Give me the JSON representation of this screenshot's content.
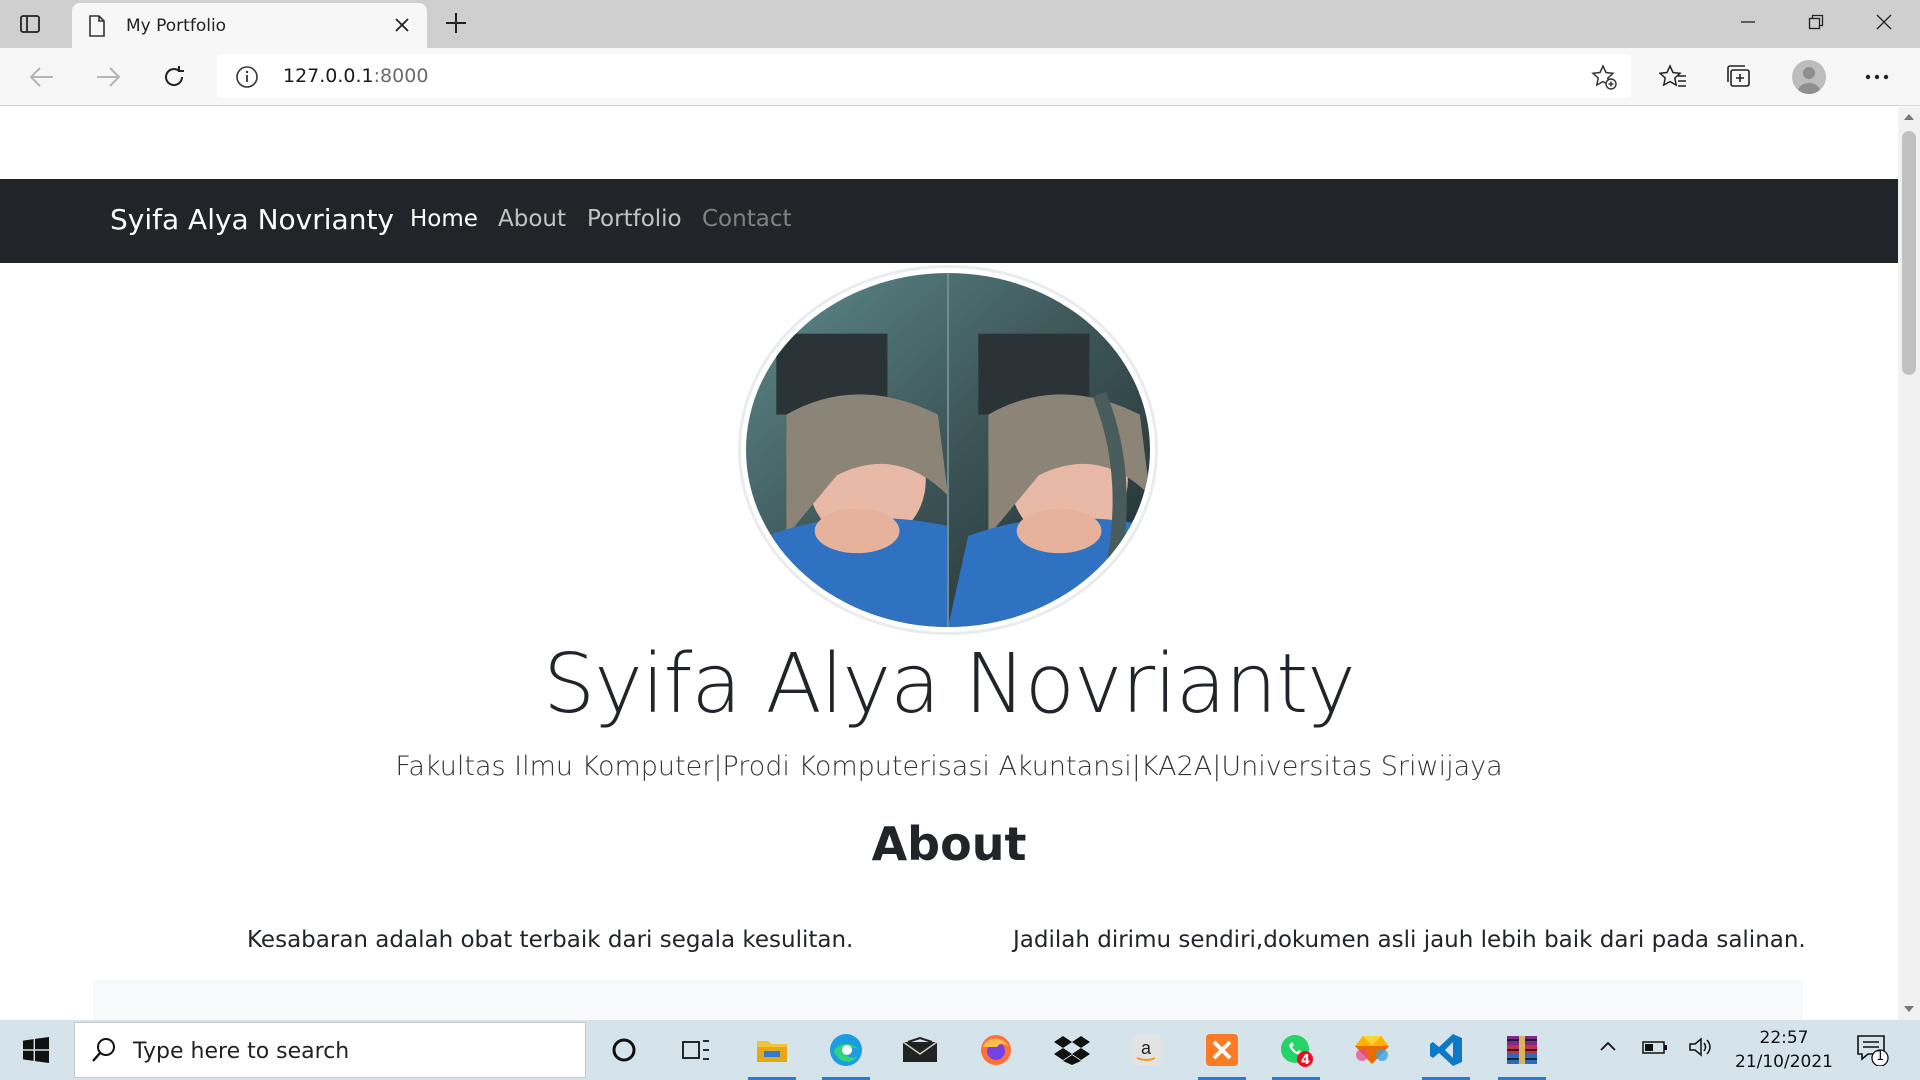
{
  "browser": {
    "tab_title": "My Portfolio",
    "url_host": "127.0.0.1",
    "url_port": ":8000"
  },
  "navbar": {
    "brand": "Syifa Alya Novrianty",
    "links": [
      {
        "label": "Home",
        "state": "active"
      },
      {
        "label": "About",
        "state": "normal"
      },
      {
        "label": "Portfolio",
        "state": "normal"
      },
      {
        "label": "Contact",
        "state": "muted"
      }
    ]
  },
  "hero": {
    "name": "Syifa Alya Novrianty",
    "subtitle": "Fakultas Ilmu Komputer|Prodi Komputerisasi Akuntansi|KA2A|Universitas Sriwijaya"
  },
  "about": {
    "title": "About",
    "quote_left": "Kesabaran adalah obat terbaik dari segala kesulitan.",
    "quote_right": "Jadilah dirimu sendiri,dokumen asli jauh lebih baik dari pada salinan."
  },
  "taskbar": {
    "search_placeholder": "Type here to search",
    "time": "22:57",
    "date": "21/10/2021",
    "whatsapp_badge": "4",
    "notification_count": "1",
    "apps": [
      "cortana-icon",
      "task-view-icon",
      "file-explorer-icon",
      "edge-icon",
      "mail-icon",
      "firefox-icon",
      "dropbox-icon",
      "amazon-icon",
      "xampp-icon",
      "whatsapp-icon",
      "sketch-icon",
      "vscode-icon",
      "winrar-icon"
    ]
  },
  "colors": {
    "navbar_bg": "#212529",
    "taskbar_bg": "#d5e3ea",
    "accent": "#2b7bd1"
  }
}
